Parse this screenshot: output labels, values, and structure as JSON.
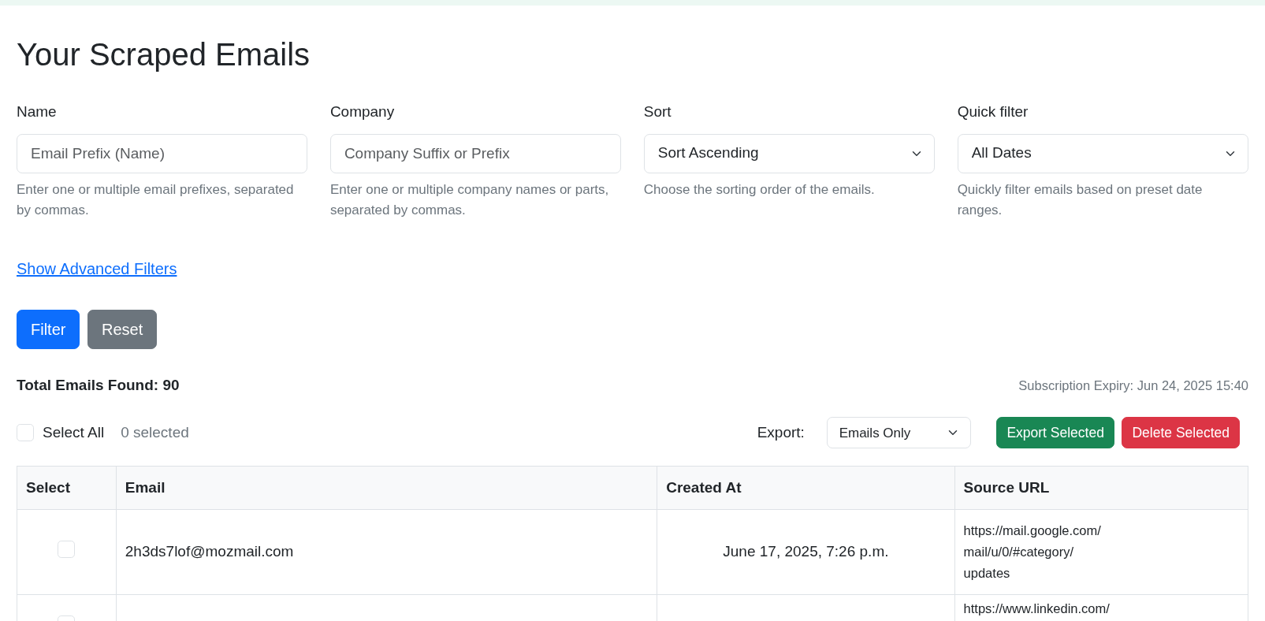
{
  "title": "Your Scraped Emails",
  "filters": [
    {
      "kind": "text",
      "label": "Name",
      "placeholder": "Email Prefix (Name)",
      "help": "Enter one or multiple email prefixes, separated by commas."
    },
    {
      "kind": "text",
      "label": "Company",
      "placeholder": "Company Suffix or Prefix",
      "help": "Enter one or multiple company names or parts, separated by commas."
    },
    {
      "kind": "select",
      "label": "Sort",
      "value": "Sort Ascending",
      "help": "Choose the sorting order of the emails."
    },
    {
      "kind": "select",
      "label": "Quick filter",
      "value": "All Dates",
      "help": "Quickly filter emails based on preset date ranges."
    }
  ],
  "advanced_link": "Show Advanced Filters",
  "buttons": [
    {
      "kind": "primary",
      "label": "Filter"
    },
    {
      "kind": "secondary",
      "label": "Reset"
    }
  ],
  "total": "Total Emails Found: 90",
  "subscription": "Subscription Expiry: Jun 24, 2025 15:40",
  "select_all": {
    "label": "Select All",
    "checked": false
  },
  "selected_count": "0 selected",
  "export": {
    "label": "Export:",
    "value": "Emails Only"
  },
  "actions": [
    {
      "kind": "success",
      "label": "Export Selected"
    },
    {
      "kind": "danger",
      "label": "Delete Selected"
    }
  ],
  "table": {
    "columns": [
      "Select",
      "Email",
      "Created At",
      "Source URL"
    ],
    "rows": [
      {
        "selected": false,
        "email": "2h3ds7lof@mozmail.com",
        "created_at": "June 17, 2025, 7:26 p.m.",
        "source_url": [
          "https://mail.google.com/",
          "mail/u/0/#category/",
          "updates"
        ]
      },
      {
        "selected": false,
        "source_url": [
          "https://www.linkedin.com/"
        ]
      }
    ]
  }
}
